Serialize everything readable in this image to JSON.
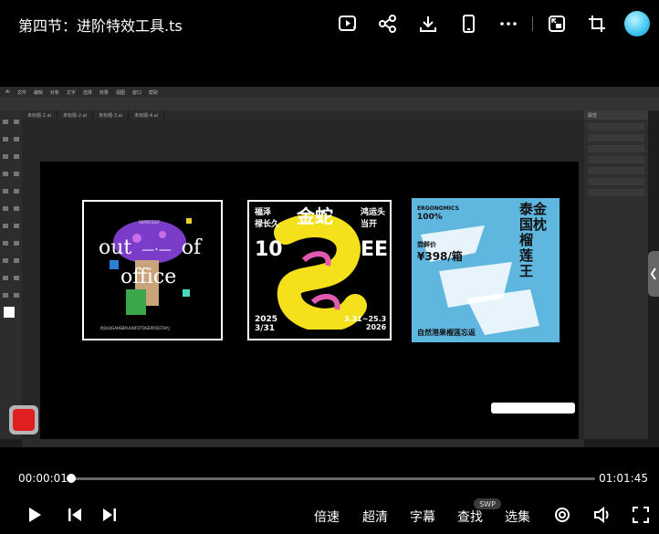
{
  "header": {
    "title": "第四节：进阶特效工具.ts",
    "icons": [
      "video-add-icon",
      "share-icon",
      "download-icon",
      "phone-icon",
      "more-icon",
      "pip-icon",
      "crop-icon",
      "avatar"
    ]
  },
  "video": {
    "card1": {
      "small_top": "REMIX EDIT",
      "line1": "out",
      "line2": "of",
      "line3": "office",
      "footer": "PJQLQGAHSBXUUDFDTQGERRQGTHY.J"
    },
    "card2": {
      "left_top": "福泽\n禄长久",
      "right_top": "鸿运头\n当开",
      "headline": "金蛇",
      "big_left": "10",
      "big_right": "EE",
      "date_left": "2025\n3/31",
      "date_right": "3.31~25.3\n2026"
    },
    "card3": {
      "brand": "ERGONOMICS",
      "pct": "100%",
      "price_label": "尝鲜价",
      "price": "¥398/箱",
      "side_title": "泰金\n国枕\n榴\n莲\n王",
      "bottom": "自然港果榴莲忘返"
    }
  },
  "player": {
    "time_current": "00:00:01",
    "time_total": "01:01:45",
    "progress_fraction": 0.0003,
    "buttons": {
      "speed": "倍速",
      "quality": "超清",
      "subtitle": "字幕",
      "search": "查找",
      "search_badge": "SWP",
      "episodes": "选集"
    }
  }
}
